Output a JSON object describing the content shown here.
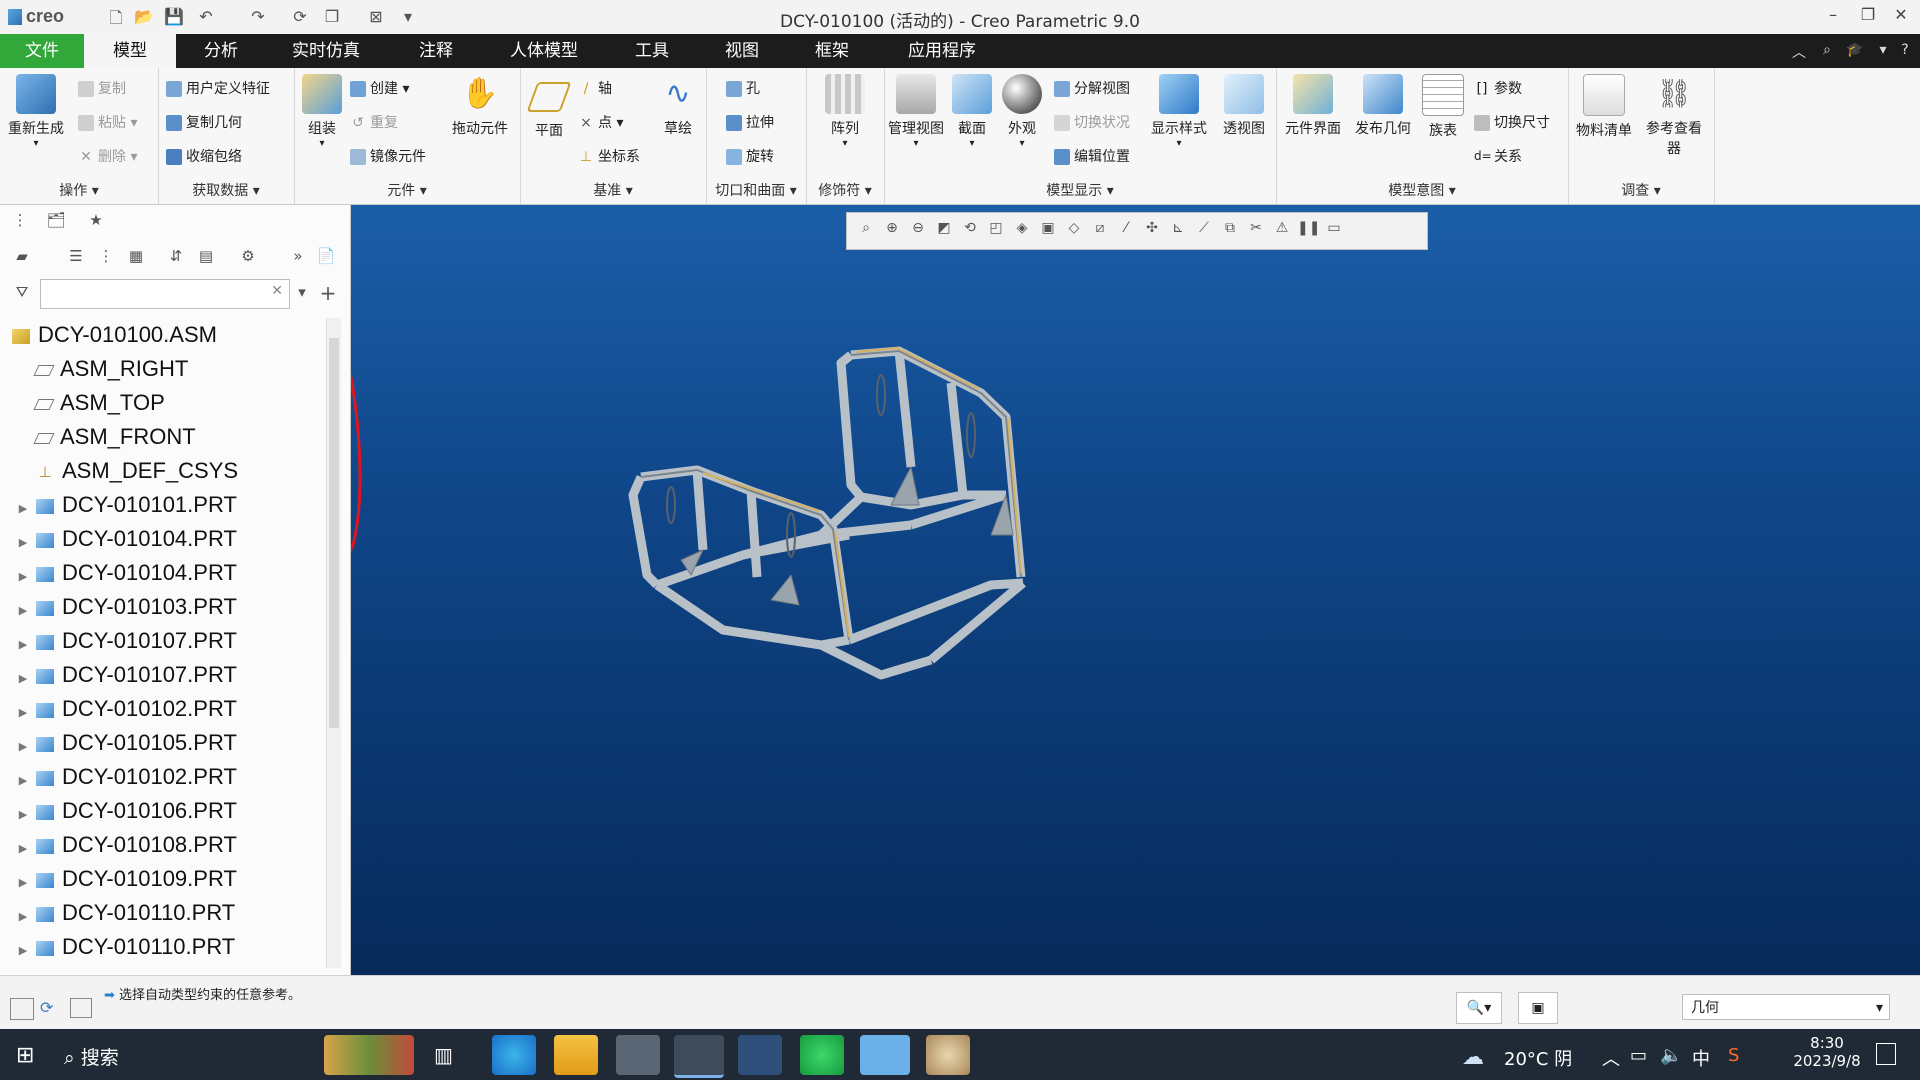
{
  "window": {
    "app_logo": "creo",
    "title": "DCY-010100 (活动的) - Creo Parametric 9.0"
  },
  "menu": {
    "file": "文件",
    "tabs": [
      "模型",
      "分析",
      "实时仿真",
      "注释",
      "人体模型",
      "工具",
      "视图",
      "框架",
      "应用程序"
    ]
  },
  "ribbon": {
    "operations": {
      "regenerate": "重新生成",
      "copy": "复制",
      "paste": "粘贴",
      "delete": "删除",
      "label": "操作"
    },
    "get_data": {
      "udf": "用户定义特征",
      "copy_geom": "复制几何",
      "shrinkwrap": "收缩包络",
      "label": "获取数据"
    },
    "component": {
      "assemble": "组装",
      "create": "创建",
      "repeat": "重复",
      "mirror": "镜像元件",
      "drag": "拖动元件",
      "label": "元件"
    },
    "datum": {
      "plane": "平面",
      "axis": "轴",
      "point": "点",
      "csys": "坐标系",
      "sketch": "草绘",
      "label": "基准"
    },
    "cut_surface": {
      "hole": "孔",
      "extrude": "拉伸",
      "revolve": "旋转",
      "label": "切口和曲面"
    },
    "modifiers": {
      "pattern": "阵列",
      "label": "修饰符"
    },
    "model_display": {
      "manage_views": "管理视图",
      "section": "截面",
      "appearance": "外观",
      "explode": "分解视图",
      "toggle_status": "切换状况",
      "edit_position": "编辑位置",
      "display_style": "显示样式",
      "perspective": "透视图",
      "label": "模型显示"
    },
    "model_intent": {
      "comp_interface": "元件界面",
      "publish_geom": "发布几何",
      "family_table": "族表",
      "params": "参数",
      "switch_dims": "切换尺寸",
      "relations": "关系",
      "label": "模型意图"
    },
    "investigate": {
      "bom": "物料清单",
      "ref_viewer": "参考查看器",
      "label": "调查"
    }
  },
  "tree": {
    "root": "DCY-010100.ASM",
    "datums": [
      "ASM_RIGHT",
      "ASM_TOP",
      "ASM_FRONT",
      "ASM_DEF_CSYS"
    ],
    "parts": [
      "DCY-010101.PRT",
      "DCY-010104.PRT",
      "DCY-010104.PRT",
      "DCY-010103.PRT",
      "DCY-010107.PRT",
      "DCY-010107.PRT",
      "DCY-010102.PRT",
      "DCY-010105.PRT",
      "DCY-010102.PRT",
      "DCY-010106.PRT",
      "DCY-010108.PRT",
      "DCY-010109.PRT",
      "DCY-010110.PRT",
      "DCY-010110.PRT"
    ]
  },
  "status": {
    "message": "选择自动类型约束的任意参考。",
    "filter_value": "几何"
  },
  "taskbar": {
    "search": "搜索",
    "weather": "20°C 阴",
    "ime": "中",
    "time": "8:30",
    "date": "2023/9/8"
  },
  "colors": {
    "file_tab": "#32a83a",
    "viewport_top": "#1b5ea8",
    "viewport_bottom": "#072a5a",
    "annotation": "#e0141e"
  }
}
